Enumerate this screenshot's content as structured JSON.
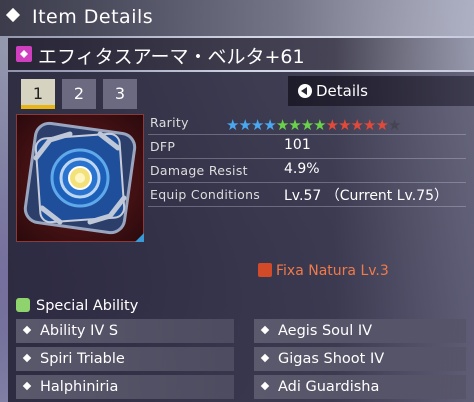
{
  "header": {
    "title": "Item Details"
  },
  "item": {
    "name": "エフィタスアーマ・ベルタ+61",
    "icon": "armor-unit-icon"
  },
  "tabs": [
    "1",
    "2",
    "3"
  ],
  "active_tab": 0,
  "details_button": {
    "label": "Details"
  },
  "stats": {
    "rarity_label": "Rarity",
    "rarity": {
      "stars": 13,
      "total": 14,
      "colors": [
        "#4aa8f0",
        "#4aa8f0",
        "#4aa8f0",
        "#4aa8f0",
        "#6ad24a",
        "#6ad24a",
        "#6ad24a",
        "#6ad24a",
        "#e04a3a",
        "#e04a3a",
        "#e04a3a",
        "#e04a3a",
        "#e04a3a",
        "#444452"
      ]
    },
    "dfp_label": "DFP",
    "dfp_value": "101",
    "damage_resist_label": "Damage Resist",
    "damage_resist_value": "4.9%",
    "equip_label": "Equip Conditions",
    "equip_value": "Lv.57 （Current Lv.75）"
  },
  "ability_flag": "Fixa Natura Lv.3",
  "special_ability": {
    "heading": "Special Ability",
    "left": [
      "Ability IV S",
      "Spiri Triable",
      "Halphiniria"
    ],
    "right": [
      "Aegis Soul IV",
      "Gigas Shoot IV",
      "Adi Guardisha"
    ]
  }
}
